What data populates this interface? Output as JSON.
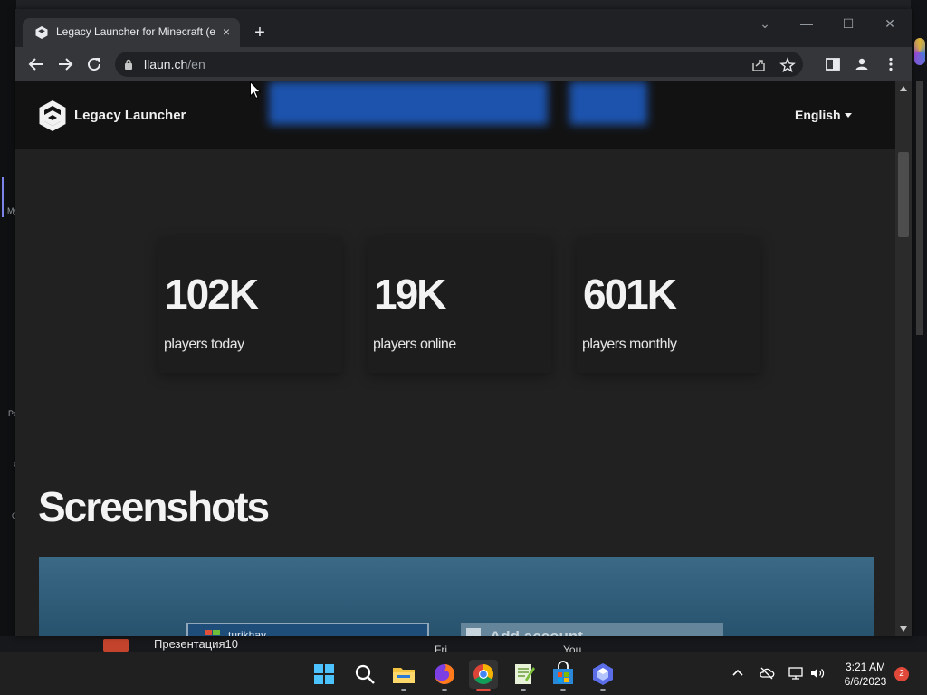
{
  "browser": {
    "tab_title": "Legacy Launcher for Minecraft (e",
    "tab_close": "×",
    "new_tab": "+",
    "url_host": "llaun.ch",
    "url_path": "/en",
    "window_controls": [
      "⌄",
      "—",
      "☐",
      "✕"
    ]
  },
  "site": {
    "name": "Legacy Launcher",
    "language": "English",
    "stats": [
      {
        "value": "102K",
        "label": "players today"
      },
      {
        "value": "19K",
        "label": "players online"
      },
      {
        "value": "601K",
        "label": "players monthly"
      }
    ],
    "screenshots_title": "Screenshots",
    "screenshot_preview": {
      "window_user": "turikhay",
      "panel_title": "Add account"
    }
  },
  "background_app": {
    "letters": [
      "My",
      "Po",
      "C",
      "C"
    ],
    "bottom_item": "Презентация10",
    "bottom_fri": "Fri",
    "bottom_you": "You"
  },
  "taskbar": {
    "apps": [
      "start-icon",
      "search-icon",
      "file-explorer-icon",
      "firefox-icon",
      "chrome-icon",
      "notepad-plus-plus-icon",
      "microsoft-store-icon",
      "copilot-icon"
    ],
    "time": "3:21 AM",
    "date": "6/6/2023",
    "notification_count": "2"
  },
  "colors": {
    "accent": "#1f5fc9",
    "page_bg": "#212121",
    "header_bg": "#121212",
    "badge": "#e0483a"
  }
}
